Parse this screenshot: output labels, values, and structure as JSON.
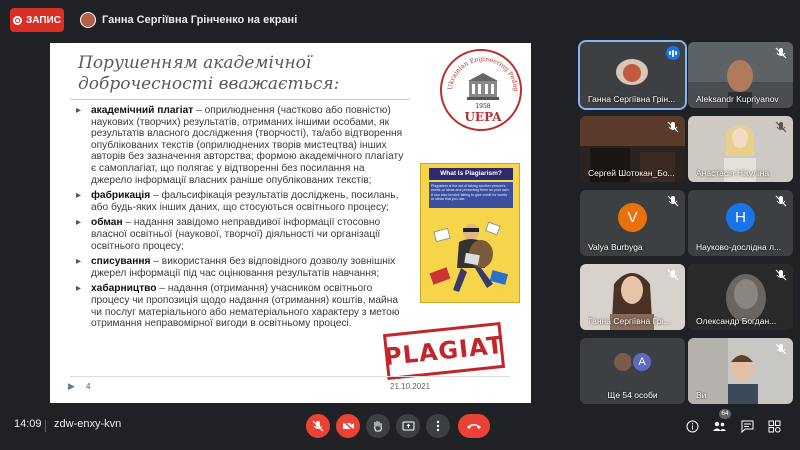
{
  "recording": {
    "label": "ЗАПИС"
  },
  "presenter_bar": {
    "text": "Ганна Сергіївна Грінченко на екрані"
  },
  "slide": {
    "title": "Порушенням академічної доброчесності вважається:",
    "logo": {
      "ring_text": "Ukrainian Engineering Pedagogics Academy",
      "year": "1958",
      "abbr": "UEPA"
    },
    "bullets": [
      {
        "term": "академічний плагіат",
        "text": " – оприлюднення (частково або повністю) наукових (творчих) результатів, отриманих іншими особами, як результатів власного дослідження (творчості), та/або відтворення опублікованих текстів (оприлюднених творів мистецтва) інших авторів без зазначення авторства; формою академічного плагіату є самоплагіат, що полягає у відтворенні без посилання на джерело інформації власних раніше опублікованих текстів;"
      },
      {
        "term": "фабрикація",
        "text": " – фальсифікація результатів досліджень, посилань, або будь-яких інших даних, що стосуються освітнього процесу;"
      },
      {
        "term": "обман",
        "text": " – надання завідомо неправдивої інформації стосовно власної освітньої (наукової, творчої) діяльності чи організації освітнього процесу;"
      },
      {
        "term": "списування",
        "text": " – використання без відповідного дозволу зовнішніх джерел інформації під час оцінювання результатів навчання;"
      },
      {
        "term": "хабарництво",
        "text": " – надання (отримання) учасником освітнього процесу чи пропозиція щодо надання (отримання) коштів, майна чи послуг матеріального або нематеріального характеру з метою отримання неправомірної вигоди в освітньому процесі."
      }
    ],
    "plagiarism_box": {
      "heading": "What Is Plagiarism?",
      "subtext": "Plagiarism is the act of taking another person's words or ideas and presenting them as your own. It can also involve failing to give credit for words or ideas that you use."
    },
    "stamp": "PLAGIAT",
    "page_number": "4",
    "date": "21.10.2021"
  },
  "participants": [
    {
      "name": "Ганна Сергіївна Грін...",
      "muted": false,
      "speaking": true,
      "type": "video"
    },
    {
      "name": "Aleksandr Kupriyanov",
      "muted": true,
      "type": "video"
    },
    {
      "name": "Сергей Шотокан_Бо...",
      "muted": true,
      "type": "video"
    },
    {
      "name": "Анастасія Нікуліна",
      "muted": true,
      "type": "video"
    },
    {
      "name": "Valya Burbyga",
      "initial": "V",
      "color": "#e8710a",
      "muted": true,
      "type": "avatar"
    },
    {
      "name": "Науково-дослідна л...",
      "initial": "Н",
      "color": "#1a73e8",
      "muted": true,
      "type": "avatar"
    },
    {
      "name": "Ганна Сергіївна Грі...",
      "muted": true,
      "type": "video"
    },
    {
      "name": "Олександр Богдан...",
      "muted": true,
      "type": "video"
    },
    {
      "name": "Ще 54 особи",
      "initial": "А",
      "color": "#5c6bc0",
      "muted": true,
      "type": "more"
    },
    {
      "name": "Ви",
      "muted": true,
      "type": "video"
    }
  ],
  "bottom_bar": {
    "time": "14:09",
    "meeting_code": "zdw-enxy-kvn",
    "participant_count": "64"
  },
  "colors": {
    "accent": "#8ab4f8",
    "danger": "#ea4335",
    "tile": "#3c4043",
    "background": "#202124"
  }
}
